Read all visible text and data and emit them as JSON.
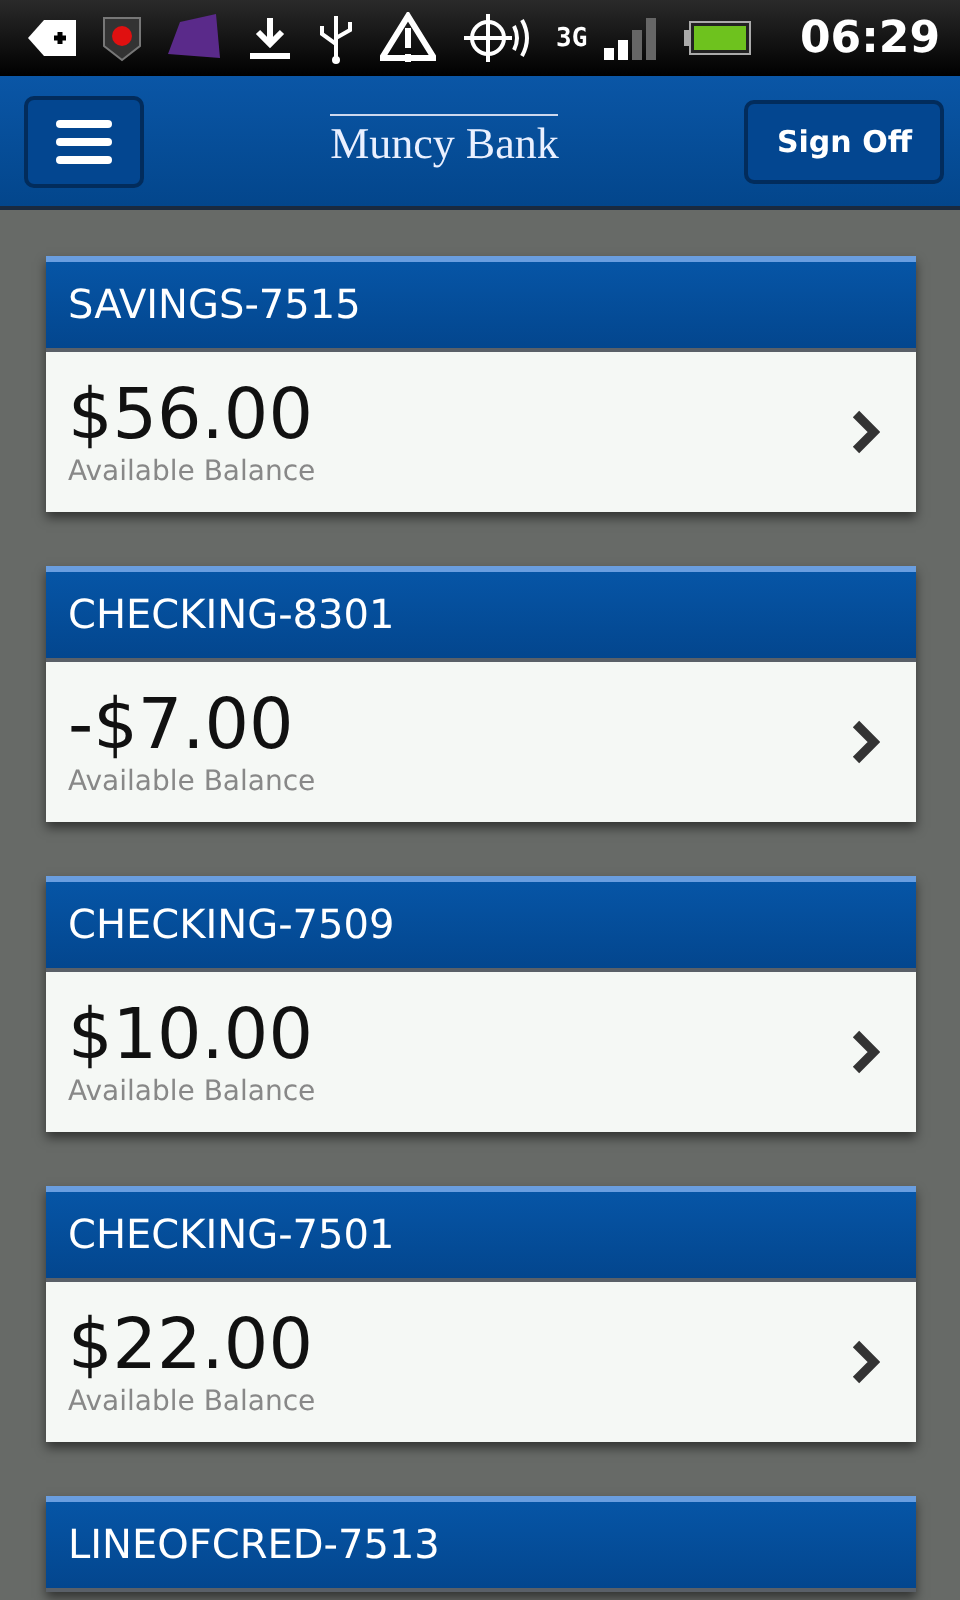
{
  "status_bar": {
    "network": "3G",
    "time": "06:29"
  },
  "header": {
    "title": "Muncy Bank",
    "sign_off": "Sign Off"
  },
  "accounts": [
    {
      "name": "SAVINGS-7515",
      "balance": "$56.00",
      "balance_label": "Available Balance"
    },
    {
      "name": "CHECKING-8301",
      "balance": "-$7.00",
      "balance_label": "Available Balance"
    },
    {
      "name": "CHECKING-7509",
      "balance": "$10.00",
      "balance_label": "Available Balance"
    },
    {
      "name": "CHECKING-7501",
      "balance": "$22.00",
      "balance_label": "Available Balance"
    },
    {
      "name": "LINEOFCRED-7513"
    }
  ]
}
